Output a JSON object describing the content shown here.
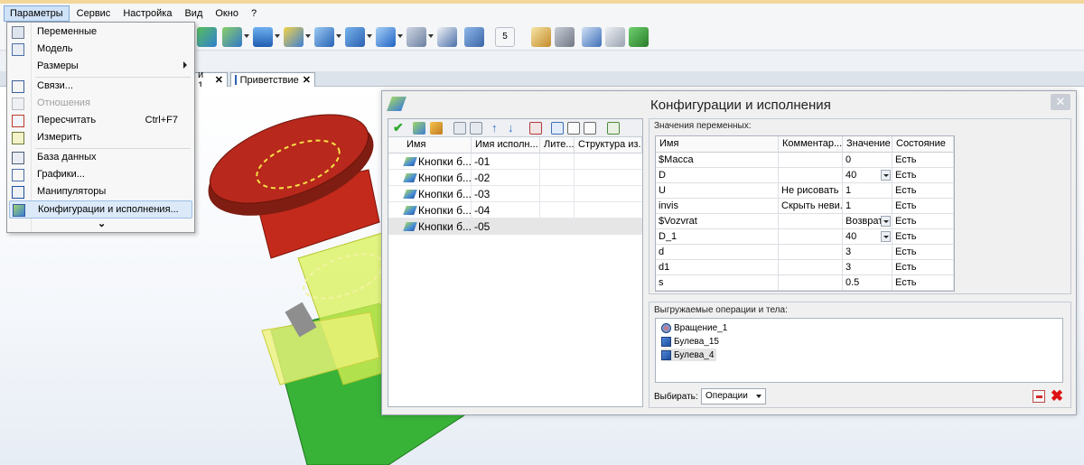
{
  "menubar": {
    "items": [
      "Параметры",
      "Сервис",
      "Настройка",
      "Вид",
      "Окно",
      "?"
    ]
  },
  "tabs": {
    "partial_tab_label": "и 1",
    "welcome_tab_label": "Приветствие",
    "close_symbol": "✕"
  },
  "toolbar": {
    "step_value": "5"
  },
  "menu": {
    "items": [
      {
        "label": "Переменные",
        "icon": "variables-icon",
        "enabled": true
      },
      {
        "label": "Модель",
        "icon": "model-icon",
        "enabled": true
      },
      {
        "label": "Размеры",
        "icon": "dimensions-icon",
        "enabled": true,
        "submenu": true
      },
      {
        "label": "Связи...",
        "icon": "links-icon",
        "enabled": true
      },
      {
        "label": "Отношения",
        "icon": "relations-icon",
        "enabled": false
      },
      {
        "label": "Пересчитать",
        "icon": "recalculate-icon",
        "enabled": true,
        "shortcut": "Ctrl+F7"
      },
      {
        "label": "Измерить",
        "icon": "measure-icon",
        "enabled": true
      },
      {
        "label": "База данных",
        "icon": "database-icon",
        "enabled": true
      },
      {
        "label": "Графики...",
        "icon": "graphs-icon",
        "enabled": true
      },
      {
        "label": "Манипуляторы",
        "icon": "manipulators-icon",
        "enabled": true
      },
      {
        "label": "Конфигурации и исполнения...",
        "icon": "configurations-icon",
        "enabled": true,
        "highlighted": true
      }
    ],
    "expand_symbol": "⌄"
  },
  "dialog": {
    "title": "Конфигурации и исполнения",
    "close_symbol": "✕",
    "left_table": {
      "headers": [
        "Имя",
        "Имя исполн...",
        "Лите...",
        "Структура из..."
      ],
      "rows": [
        {
          "name": "Кнопки б...",
          "variant": "-01"
        },
        {
          "name": "Кнопки б...",
          "variant": "-02"
        },
        {
          "name": "Кнопки б...",
          "variant": "-03"
        },
        {
          "name": "Кнопки б...",
          "variant": "-04"
        },
        {
          "name": "Кнопки б...",
          "variant": "-05",
          "selected": true
        }
      ]
    },
    "variables": {
      "caption": "Значения переменных:",
      "headers": [
        "Имя",
        "Комментар...",
        "Значение",
        "Состояние"
      ],
      "rows": [
        {
          "name": "$Масса",
          "comment": "",
          "value": "0",
          "state": "Есть",
          "combo": false
        },
        {
          "name": "D",
          "comment": "",
          "value": "40",
          "state": "Есть",
          "combo": true
        },
        {
          "name": "U",
          "comment": "Не рисовать ...",
          "value": "1",
          "state": "Есть",
          "combo": false
        },
        {
          "name": "invis",
          "comment": "Скрыть неви...",
          "value": "1",
          "state": "Есть",
          "combo": false
        },
        {
          "name": "$Vozvrat",
          "comment": "",
          "value": "Возврат",
          "state": "Есть",
          "combo": true
        },
        {
          "name": "D_1",
          "comment": "",
          "value": "40",
          "state": "Есть",
          "combo": true
        },
        {
          "name": "d",
          "comment": "",
          "value": "3",
          "state": "Есть",
          "combo": false
        },
        {
          "name": "d1",
          "comment": "",
          "value": "3",
          "state": "Есть",
          "combo": false
        },
        {
          "name": "s",
          "comment": "",
          "value": "0.5",
          "state": "Есть",
          "combo": false
        }
      ]
    },
    "operations": {
      "caption": "Выгружаемые операции и тела:",
      "items": [
        {
          "label": "Вращение_1",
          "icon": "rotation-icon"
        },
        {
          "label": "Булева_15",
          "icon": "boolean-icon"
        },
        {
          "label": "Булева_4",
          "icon": "boolean-icon",
          "selected": true
        }
      ],
      "select_label": "Выбирать:",
      "select_value": "Операции"
    }
  },
  "colors": {
    "part_red": "#b8281c",
    "part_yellow": "#e8f060",
    "part_green": "#3fb83a",
    "menu_highlight": "#dbe9f8"
  }
}
